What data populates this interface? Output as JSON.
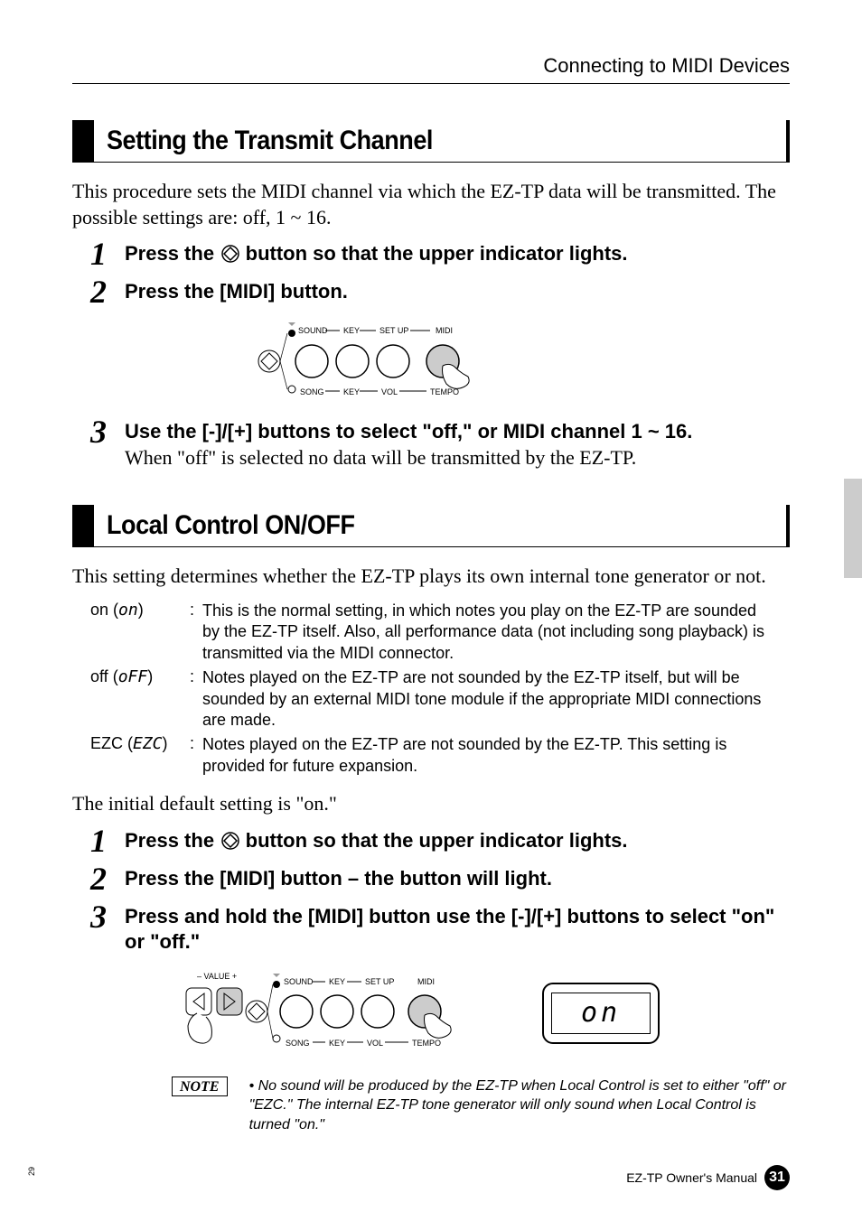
{
  "header": "Connecting to MIDI Devices",
  "section1": {
    "heading": "Setting the Transmit Channel",
    "intro": "This procedure sets the MIDI channel via which the EZ-TP data will be transmitted. The possible settings are: off, 1 ~ 16.",
    "steps": {
      "s1a": "Press the ",
      "s1b": " button so that the upper indicator lights.",
      "s2": "Press the [MIDI] button.",
      "s3_title": "Use the [-]/[+] buttons to select \"off,\" or MIDI channel 1 ~ 16.",
      "s3_desc": "When \"off\" is selected no data will be transmitted by the EZ-TP."
    }
  },
  "section2": {
    "heading": "Local Control ON/OFF",
    "intro": "This setting determines whether the EZ-TP plays its own internal tone generator or not.",
    "defs": {
      "on_term": "on",
      "on_seg": "on",
      "on_desc": "This is the normal setting, in which notes you play on the EZ-TP are sounded by the EZ-TP itself. Also, all performance data (not including song playback) is transmitted via the MIDI connector.",
      "off_term": "off",
      "off_seg": "oFF",
      "off_desc": "Notes played on the EZ-TP are not sounded by the EZ-TP itself, but will be sounded by an external MIDI tone module if the appropriate MIDI connections are made.",
      "ezc_term": "EZC",
      "ezc_seg": "EZC",
      "ezc_desc": "Notes played on the EZ-TP are not sounded by the EZ-TP. This setting is provided for future expansion."
    },
    "default_text": "The initial default setting is \"on.\"",
    "steps": {
      "s1a": "Press the ",
      "s1b": " button so that the upper indicator lights.",
      "s2": "Press the [MIDI] button – the button will light.",
      "s3": "Press and hold the [MIDI] button use the [-]/[+] buttons to select \"on\" or \"off.\""
    },
    "lcd": "on",
    "note_label": "NOTE",
    "note_text": "• No sound will be produced by the EZ-TP when Local Control is set to either \"off\" or \"EZC.\" The internal EZ-TP tone generator will only sound when Local Control is turned \"on.\""
  },
  "panel_labels": {
    "sound": "SOUND",
    "key": "KEY",
    "setup": "SET UP",
    "midi": "MIDI",
    "song": "SONG",
    "vol": "VOL",
    "tempo": "TEMPO",
    "value": "VALUE"
  },
  "footer": {
    "book": "EZ-TP  Owner's Manual",
    "page": "31",
    "side": "29"
  }
}
